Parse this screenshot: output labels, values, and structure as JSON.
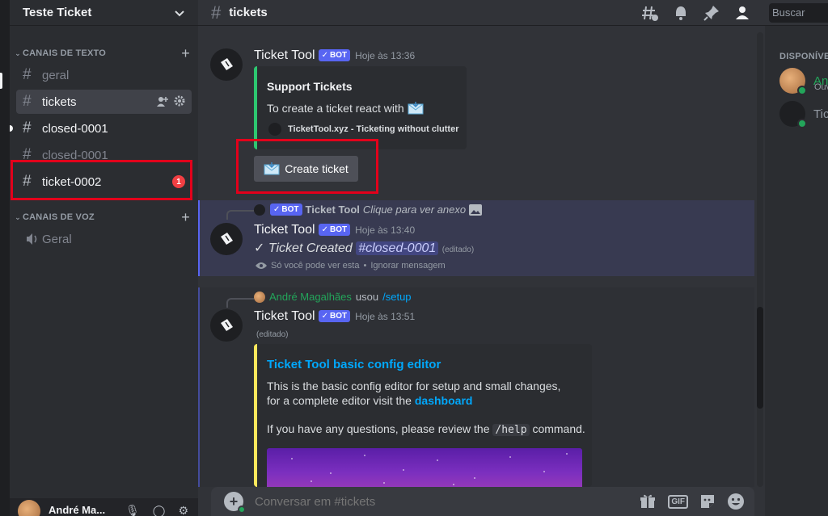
{
  "server": {
    "name": "Teste Ticket"
  },
  "sidebar": {
    "text_category": "CANAIS DE TEXTO",
    "voice_category": "CANAIS DE VOZ",
    "channels": [
      {
        "name": "geral"
      },
      {
        "name": "tickets"
      },
      {
        "name": "closed-0001"
      },
      {
        "name": "closed-0001"
      },
      {
        "name": "ticket-0002",
        "badge": "1"
      }
    ],
    "voice_channels": [
      {
        "name": "Geral"
      }
    ]
  },
  "user": {
    "name": "André Ma..."
  },
  "header": {
    "channel": "tickets",
    "search_placeholder": "Buscar"
  },
  "members": {
    "heading": "DISPONÍVEL",
    "items": [
      {
        "name": "André Magalhães",
        "sub": "Ouvindo"
      },
      {
        "name": "Ticket Tool"
      }
    ]
  },
  "messages": {
    "m1": {
      "author": "Ticket Tool",
      "bot_label": "BOT",
      "time": "Hoje às 13:36",
      "embed_title": "Support Tickets",
      "embed_text": "To create a ticket react with",
      "embed_footer": "TicketTool.xyz - Ticketing without clutter",
      "button_label": "Create ticket"
    },
    "m2": {
      "reply_author": "Ticket Tool",
      "reply_bot_label": "BOT",
      "reply_text": "Clique para ver anexo",
      "author": "Ticket Tool",
      "bot_label": "BOT",
      "time": "Hoje às 13:40",
      "body_prefix": "✓ Ticket Created",
      "mention": "#closed-0001",
      "edited": "(editado)",
      "ephemeral_text": "Só você pode ver esta",
      "dismiss": "Ignorar mensagem"
    },
    "m3": {
      "reply_user": "André Magalhães",
      "reply_used": "usou",
      "reply_command": "/setup",
      "author": "Ticket Tool",
      "bot_label": "BOT",
      "time": "Hoje às 13:51",
      "edited": "(editado)",
      "embed_title": "Ticket Tool basic config editor",
      "line1": "This is the basic config editor for setup and small changes,",
      "line2_prefix": "for a complete editor visit the",
      "line2_link": "dashboard",
      "line3_prefix": "If you have any questions, please review the",
      "line3_code": "/help",
      "line3_suffix": "command."
    }
  },
  "composer": {
    "placeholder": "Conversar em #tickets"
  },
  "colors": {
    "accent": "#5865f2",
    "online": "#23a55a",
    "highlight_box": "#e3001b",
    "embed_green": "#2dc770",
    "embed_yellow": "#fee75c"
  }
}
